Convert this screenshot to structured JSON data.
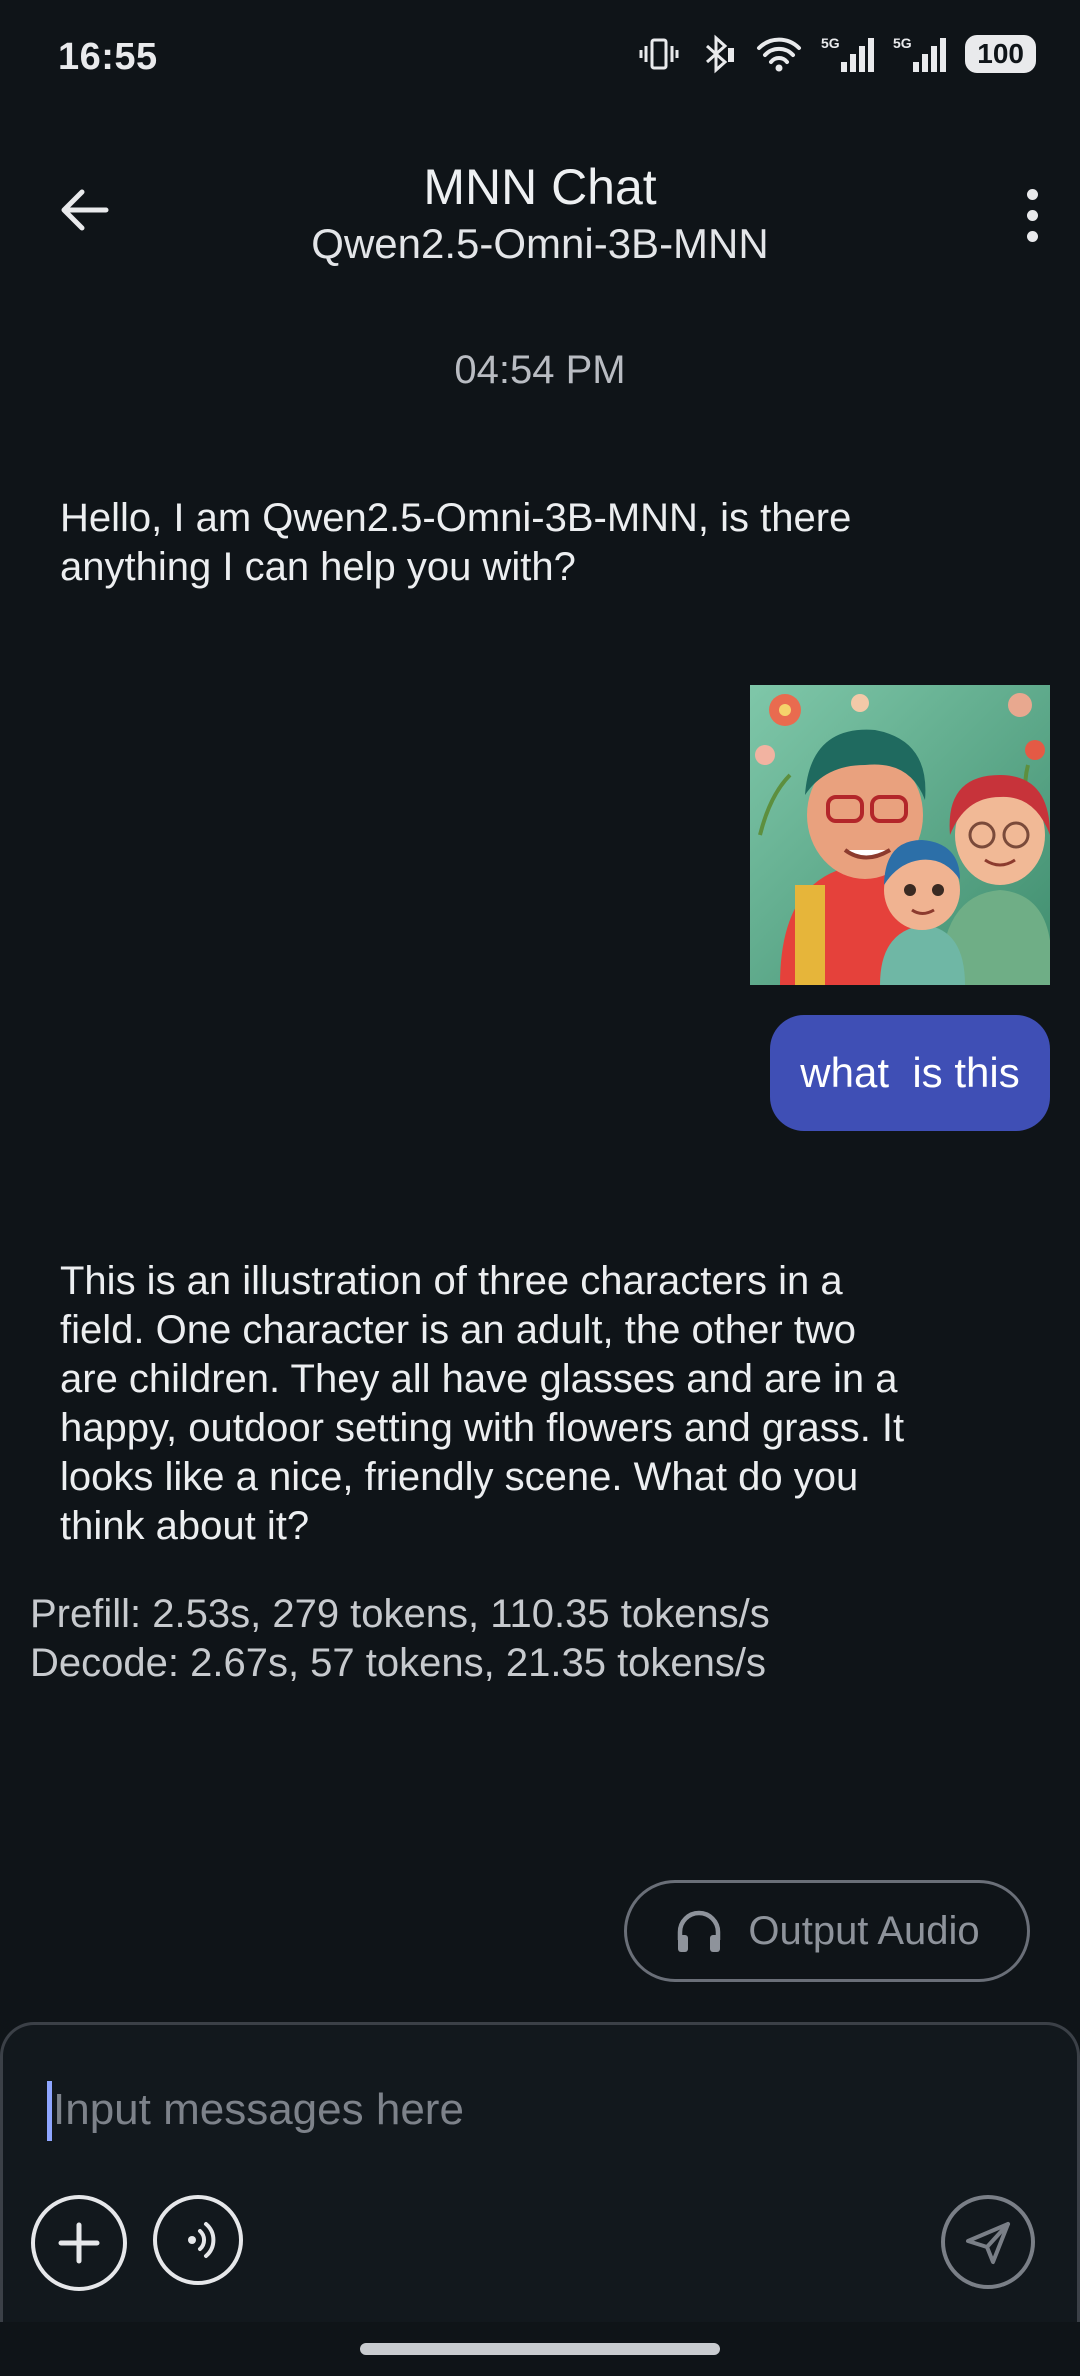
{
  "status_bar": {
    "time": "16:55",
    "network_1": "5G",
    "network_2": "5G",
    "battery": "100",
    "icons": [
      "vibrate-icon",
      "bluetooth-icon",
      "wifi-icon",
      "signal-icon",
      "signal-icon",
      "battery-icon"
    ]
  },
  "header": {
    "title": "MNN Chat",
    "subtitle": "Qwen2.5-Omni-3B-MNN",
    "back_icon": "arrow-left-icon",
    "menu_icon": "more-vertical-icon"
  },
  "chat": {
    "timestamp": "04:54 PM",
    "greeting": "Hello, I am Qwen2.5-Omni-3B-MNN, is there anything I can help you with?",
    "user_image": "image",
    "user_message": "what  is this",
    "bot_answer": "This is an illustration of three characters in a field. One character is an adult, the other two are children. They all have glasses and are in a happy, outdoor setting with flowers and grass. It looks like a nice, friendly scene. What do you think about it?",
    "stats_prefill": "Prefill: 2.53s, 279 tokens, 110.35 tokens/s",
    "stats_decode": "Decode: 2.67s, 57 tokens, 21.35 tokens/s"
  },
  "controls": {
    "output_audio_label": "Output Audio",
    "input_placeholder": "Input messages here",
    "input_value": ""
  },
  "colors": {
    "background": "#0f1418",
    "user_bubble": "#3f4fb5",
    "accent_caret": "#8fa6ff"
  }
}
